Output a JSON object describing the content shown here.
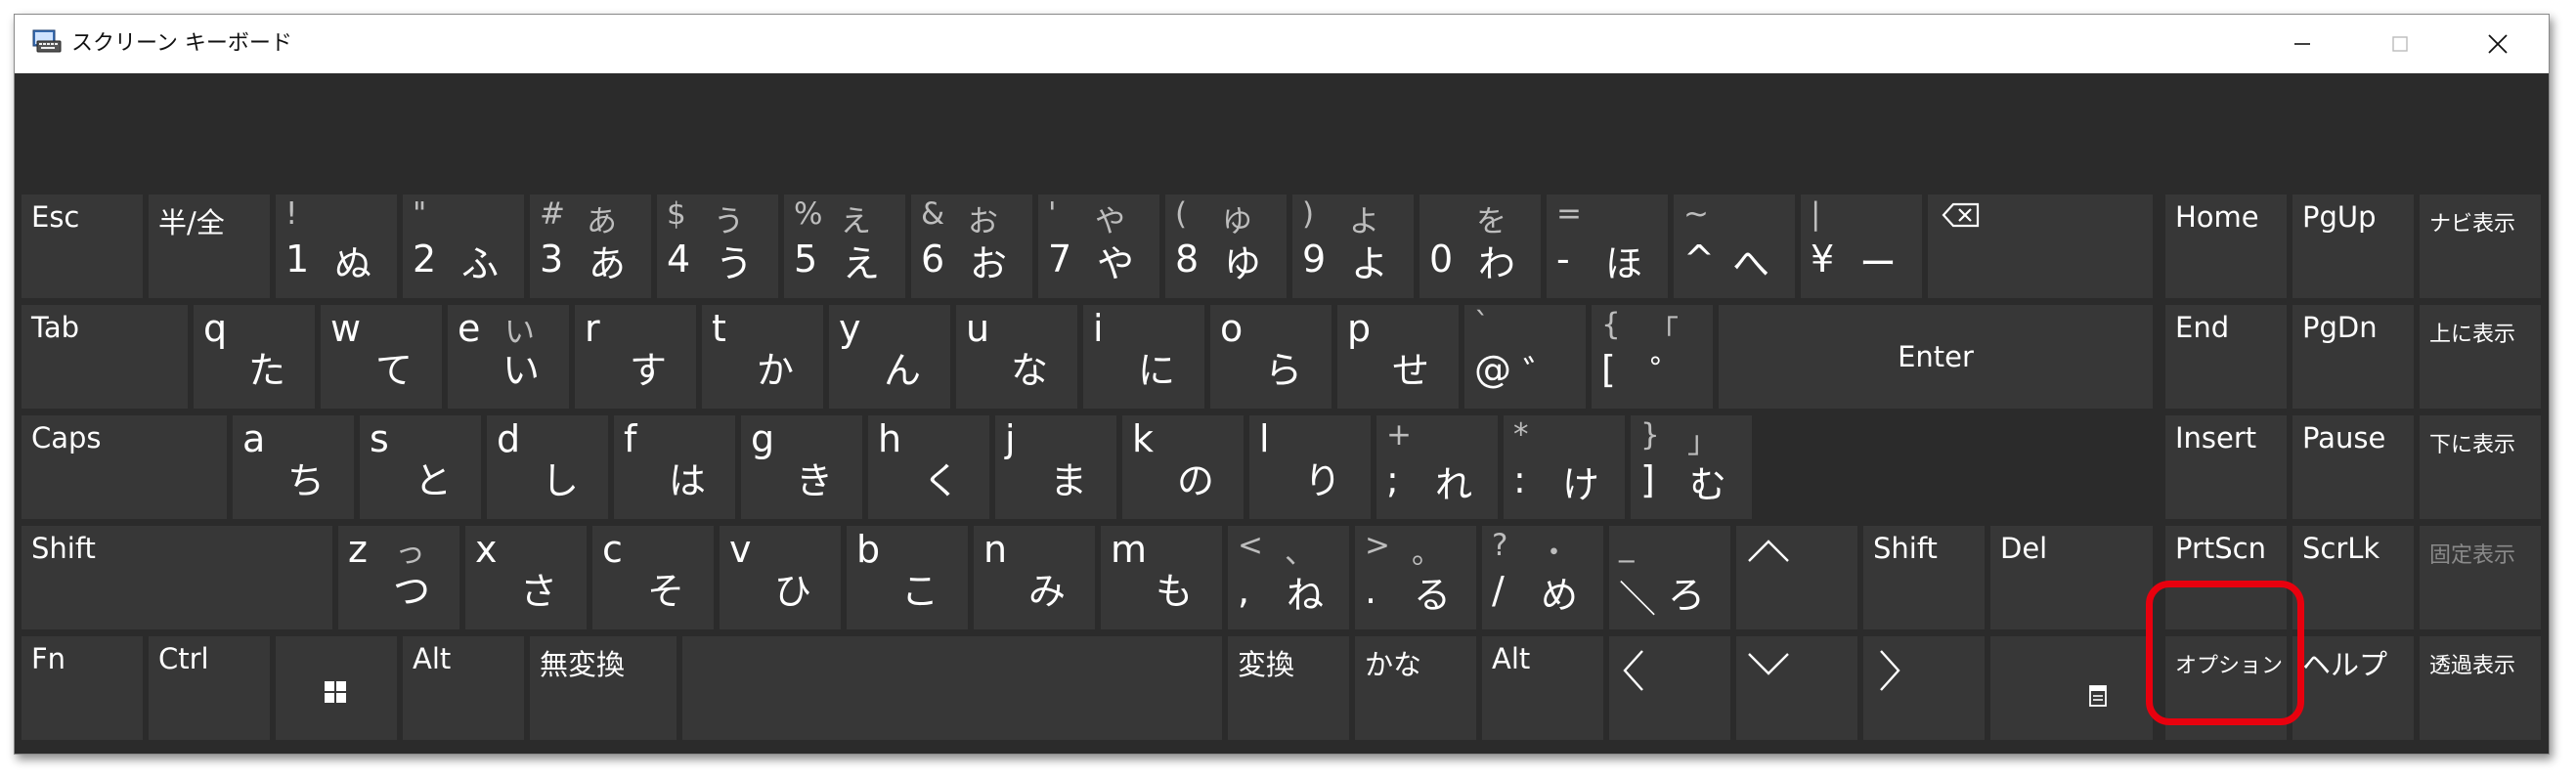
{
  "window": {
    "title": "スクリーン キーボード",
    "controls": {
      "minimize": "minimize-icon",
      "maximize": "maximize-icon",
      "close": "close-icon"
    }
  },
  "keys": {
    "esc": "Esc",
    "hankaku": "半/全",
    "k1": {
      "tl": "!",
      "tr": "",
      "bl": "1",
      "br": "ぬ"
    },
    "k2": {
      "tl": "\"",
      "tr": "",
      "bl": "2",
      "br": "ふ"
    },
    "k3": {
      "tl": "#",
      "tr": "あ",
      "bl": "3",
      "br": "あ"
    },
    "k4": {
      "tl": "$",
      "tr": "う",
      "bl": "4",
      "br": "う"
    },
    "k5": {
      "tl": "%",
      "tr": "え",
      "bl": "5",
      "br": "え"
    },
    "k6": {
      "tl": "&",
      "tr": "お",
      "bl": "6",
      "br": "お"
    },
    "k7": {
      "tl": "'",
      "tr": "や",
      "bl": "7",
      "br": "や"
    },
    "k8": {
      "tl": "(",
      "tr": "ゆ",
      "bl": "8",
      "br": "ゆ"
    },
    "k9": {
      "tl": ")",
      "tr": "よ",
      "bl": "9",
      "br": "よ"
    },
    "k0": {
      "tl": "",
      "tr": "を",
      "bl": "0",
      "br": "わ"
    },
    "kminus": {
      "tl": "=",
      "tr": "",
      "bl": "-",
      "br": "ほ"
    },
    "kcaret": {
      "tl": "~",
      "tr": "",
      "bl": "^",
      "br": "へ"
    },
    "kyen": {
      "tl": "|",
      "tr": "",
      "bl": "¥",
      "br": "ー"
    },
    "backspace": "backspace-icon",
    "tab": "Tab",
    "q": {
      "lt": "q",
      "lr": "た"
    },
    "w": {
      "lt": "w",
      "lr": "て"
    },
    "e": {
      "lt": "e",
      "tr": "い",
      "lr": "い"
    },
    "r": {
      "lt": "r",
      "lr": "す"
    },
    "t": {
      "lt": "t",
      "lr": "か"
    },
    "y": {
      "lt": "y",
      "lr": "ん"
    },
    "u": {
      "lt": "u",
      "lr": "な"
    },
    "i": {
      "lt": "i",
      "lr": "に"
    },
    "o": {
      "lt": "o",
      "lr": "ら"
    },
    "p": {
      "lt": "p",
      "lr": "せ"
    },
    "at": {
      "tl": "`",
      "bl": "@",
      "br": "゛"
    },
    "bracket": {
      "tl": "{",
      "tr": "「",
      "bl": "[",
      "br": "゜"
    },
    "enter": "Enter",
    "caps": "Caps",
    "a": {
      "lt": "a",
      "lr": "ち"
    },
    "s": {
      "lt": "s",
      "lr": "と"
    },
    "d": {
      "lt": "d",
      "lr": "し"
    },
    "f": {
      "lt": "f",
      "lr": "は"
    },
    "g": {
      "lt": "g",
      "lr": "き"
    },
    "h": {
      "lt": "h",
      "lr": "く"
    },
    "j": {
      "lt": "j",
      "lr": "ま"
    },
    "k": {
      "lt": "k",
      "lr": "の"
    },
    "l": {
      "lt": "l",
      "lr": "り"
    },
    "semicolon": {
      "tl": "+",
      "bl": ";",
      "br": "れ"
    },
    "colon": {
      "tl": "*",
      "bl": ":",
      "br": "け"
    },
    "rbracket": {
      "tl": "}",
      "tr": "」",
      "bl": "]",
      "br": "む"
    },
    "shift_l": "Shift",
    "z": {
      "lt": "z",
      "tr": "っ",
      "lr": "つ"
    },
    "x": {
      "lt": "x",
      "lr": "さ"
    },
    "c": {
      "lt": "c",
      "lr": "そ"
    },
    "v": {
      "lt": "v",
      "lr": "ひ"
    },
    "b": {
      "lt": "b",
      "lr": "こ"
    },
    "n": {
      "lt": "n",
      "lr": "み"
    },
    "m": {
      "lt": "m",
      "lr": "も"
    },
    "comma": {
      "tl": "<",
      "tr": "、",
      "bl": ",",
      "br": "ね"
    },
    "period": {
      "tl": ">",
      "tr": "。",
      "bl": ".",
      "br": "る"
    },
    "slash": {
      "tl": "?",
      "tr": "・",
      "bl": "/",
      "br": "め"
    },
    "backslash": {
      "tl": "_",
      "bl": "＼",
      "br": "ろ"
    },
    "up": "up-arrow-icon",
    "shift_r": "Shift",
    "del": "Del",
    "fn": "Fn",
    "ctrl": "Ctrl",
    "win": "windows-logo-icon",
    "alt_l": "Alt",
    "muhenkan": "無変換",
    "space": "",
    "henkan": "変換",
    "kana": "かな",
    "alt_r": "Alt",
    "left": "left-arrow-icon",
    "down": "down-arrow-icon",
    "right": "right-arrow-icon",
    "menu": "context-menu-icon",
    "home": "Home",
    "pgup": "PgUp",
    "navi": "ナビ表示",
    "end": "End",
    "pgdn": "PgDn",
    "up_display": "上に表示",
    "insert": "Insert",
    "pause": "Pause",
    "down_display": "下に表示",
    "prtscn": "PrtScn",
    "scrlk": "ScrLk",
    "fixed_display": "固定表示",
    "options": "オプション",
    "help": "ヘルプ",
    "transparent": "透過表示"
  },
  "colors": {
    "window_bg": "#2b2b2b",
    "key_bg": "#373737",
    "highlight": "#e8000e",
    "dim_text": "#8a8a8a"
  }
}
